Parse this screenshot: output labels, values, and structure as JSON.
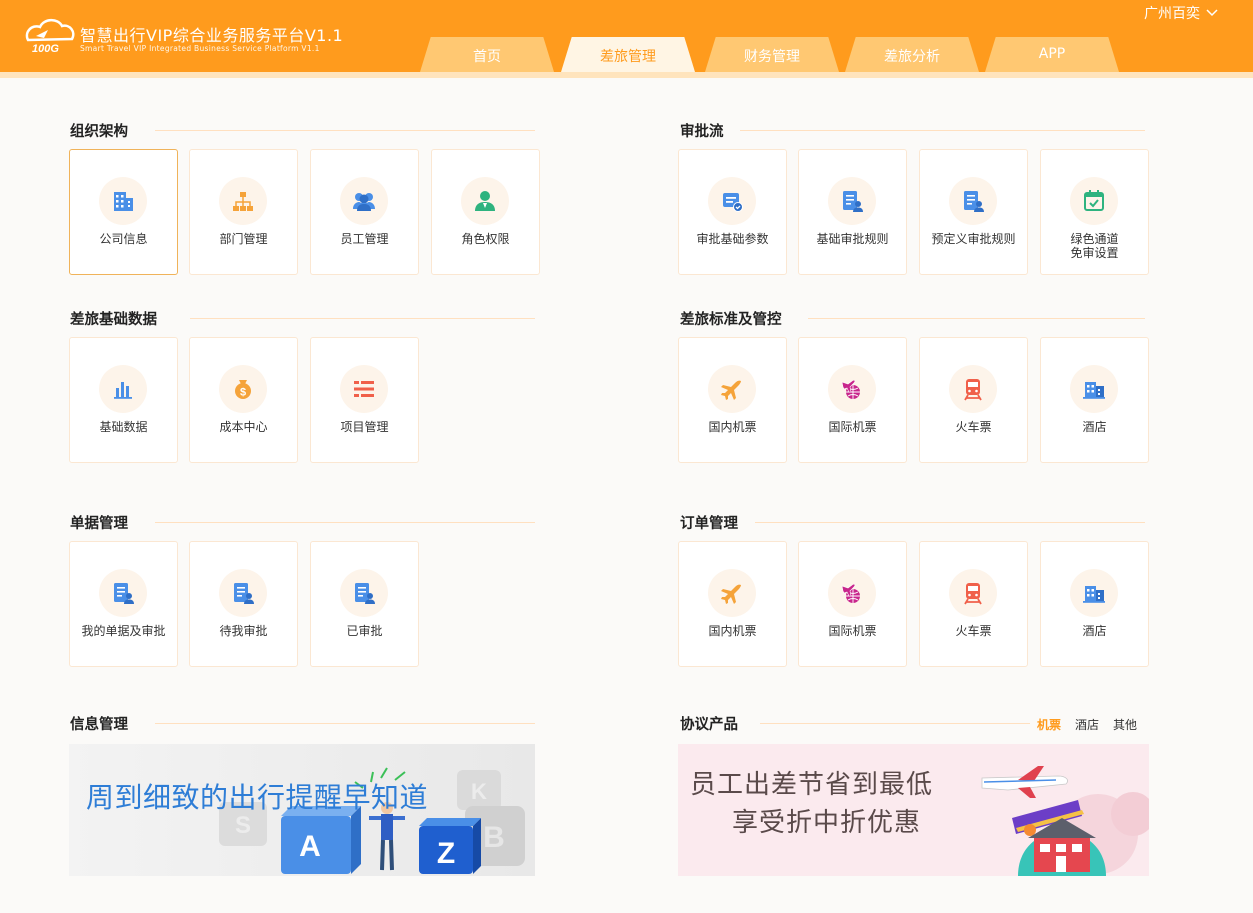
{
  "header": {
    "brand_title": "智慧出行VIP综合业务服务平台V1.1",
    "brand_subtitle": "Smart Travel VIP Integrated Business Service Platform V1.1",
    "logo_text": "100G",
    "city": "广州百奕",
    "tabs": [
      {
        "label": "首页",
        "active": false
      },
      {
        "label": "差旅管理",
        "active": true
      },
      {
        "label": "财务管理",
        "active": false
      },
      {
        "label": "差旅分析",
        "active": false
      },
      {
        "label": "APP",
        "active": false
      }
    ],
    "accent_color": "#ff9b1d"
  },
  "sections": {
    "org": {
      "title": "组织架构",
      "items": [
        {
          "label": "公司信息",
          "icon": "building-icon"
        },
        {
          "label": "部门管理",
          "icon": "org-chart-icon"
        },
        {
          "label": "员工管理",
          "icon": "people-icon"
        },
        {
          "label": "角色权限",
          "icon": "user-role-icon"
        }
      ]
    },
    "approval": {
      "title": "审批流",
      "items": [
        {
          "label": "审批基础参数",
          "icon": "approval-params-icon"
        },
        {
          "label": "基础审批规则",
          "icon": "document-user-icon"
        },
        {
          "label": "预定义审批规则",
          "icon": "document-user-icon"
        },
        {
          "label": "绿色通道\n免审设置",
          "icon": "calendar-check-icon"
        }
      ]
    },
    "basedata": {
      "title": "差旅基础数据",
      "items": [
        {
          "label": "基础数据",
          "icon": "bar-chart-icon"
        },
        {
          "label": "成本中心",
          "icon": "money-bag-icon"
        },
        {
          "label": "项目管理",
          "icon": "list-icon"
        }
      ]
    },
    "standard": {
      "title": "差旅标准及管控",
      "items": [
        {
          "label": "国内机票",
          "icon": "plane-icon"
        },
        {
          "label": "国际机票",
          "icon": "globe-plane-icon"
        },
        {
          "label": "火车票",
          "icon": "train-icon"
        },
        {
          "label": "酒店",
          "icon": "hotel-icon"
        }
      ]
    },
    "docs": {
      "title": "单据管理",
      "items": [
        {
          "label": "我的单据及审批",
          "icon": "document-user-icon"
        },
        {
          "label": "待我审批",
          "icon": "document-user-icon"
        },
        {
          "label": "已审批",
          "icon": "document-user-icon"
        }
      ]
    },
    "orders": {
      "title": "订单管理",
      "items": [
        {
          "label": "国内机票",
          "icon": "plane-icon"
        },
        {
          "label": "国际机票",
          "icon": "globe-plane-icon"
        },
        {
          "label": "火车票",
          "icon": "train-icon"
        },
        {
          "label": "酒店",
          "icon": "hotel-icon"
        }
      ]
    },
    "info": {
      "title": "信息管理",
      "banner_text": "周到细致的出行提醒早知道",
      "banner_letters": [
        "A",
        "Z"
      ]
    },
    "protocol": {
      "title": "协议产品",
      "tabs": [
        "机票",
        "酒店",
        "其他"
      ],
      "active_tab": "机票",
      "banner_line1": "员工出差节省到最低",
      "banner_line2": "享受折中折优惠"
    }
  }
}
